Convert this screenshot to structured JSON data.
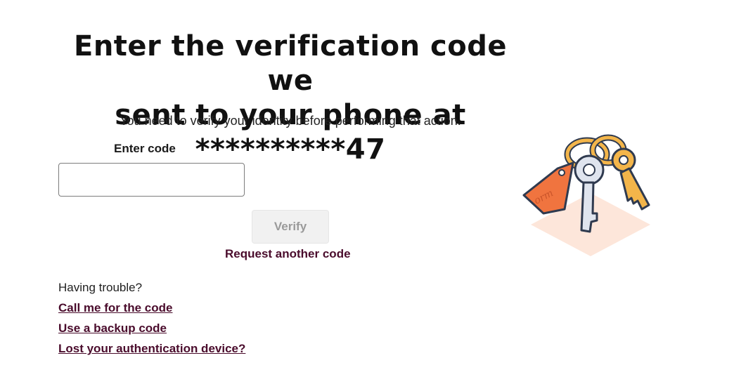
{
  "heading": {
    "line1": "Enter the verification code we",
    "line2": "sent to your phone at **********47"
  },
  "subtitle": "You need to verify your identity before performing that action.",
  "form": {
    "code_label": "Enter code",
    "code_value": "",
    "verify_label": "Verify",
    "request_label": "Request another code"
  },
  "help": {
    "trouble_text": "Having trouble?",
    "call_link": "Call me for the code",
    "backup_link": "Use a backup code",
    "lost_link": "Lost your authentication device?"
  },
  "illustration": {
    "icon": "keychain-icon",
    "tag_text": "orm"
  },
  "colors": {
    "link": "#4a0c2c",
    "button_disabled_bg": "#f1f1f1",
    "button_disabled_text": "#9a9a9a",
    "tag_orange": "#f0743f",
    "ring_gold": "#f3b54a"
  }
}
